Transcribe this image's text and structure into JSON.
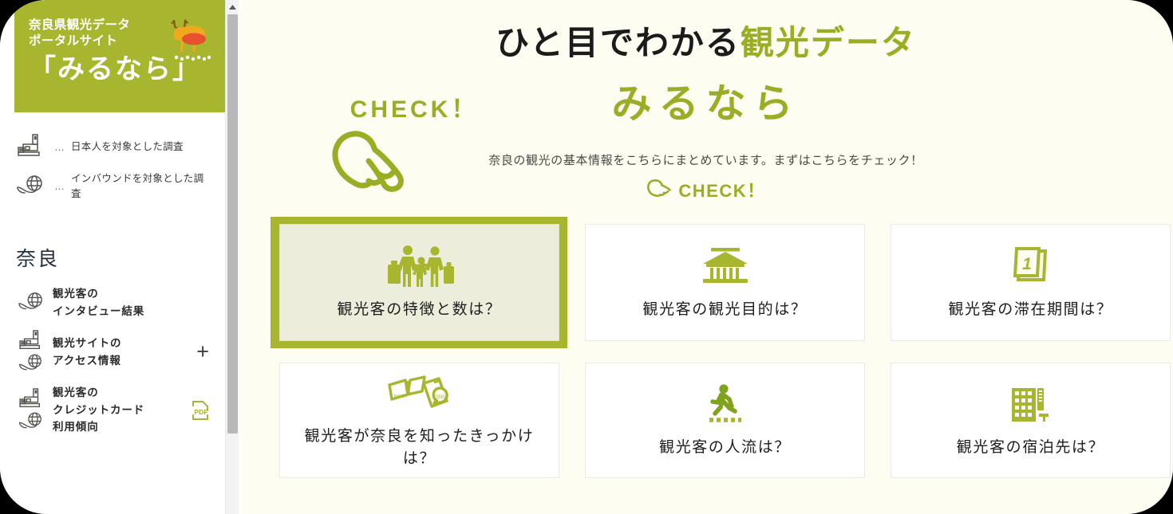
{
  "colors": {
    "brand_green": "#a8b62f",
    "accent_green": "#9aad24",
    "main_bg": "#fdfdf2",
    "card_bg": "#ffffff",
    "selected_card_bg": "#eceedb",
    "text_dark": "#1b1b1b",
    "deer_body": "#e8512f",
    "deer_legs": "#f0a81e"
  },
  "sidebar": {
    "brand": {
      "line1": "奈良県観光データ",
      "line2": "ポータルサイト",
      "main": "「みるなら」",
      "logo_icon": "deer-icon"
    },
    "legend": [
      {
        "icon": "buddha-statue-icon",
        "dots": "…",
        "label": "日本人を対象とした調査"
      },
      {
        "icon": "globe-hand-icon",
        "dots": "…",
        "label": "インバウンドを対象とした調査"
      }
    ],
    "section_title": "奈良",
    "nav_items": [
      {
        "icons": [
          "globe-hand-icon"
        ],
        "label": "観光客の\nインタビュー結果",
        "label_lines": [
          "観光客の",
          "インタビュー結果"
        ],
        "expander": null,
        "badge": null
      },
      {
        "icons": [
          "buddha-statue-icon",
          "globe-hand-icon"
        ],
        "label": "観光サイトの\nアクセス情報",
        "label_lines": [
          "観光サイトの",
          "アクセス情報"
        ],
        "expander": "+",
        "badge": null
      },
      {
        "icons": [
          "buddha-statue-icon",
          "globe-hand-icon"
        ],
        "label": "観光客の\nクレジットカード\n利用傾向",
        "label_lines": [
          "観光客の",
          "クレジットカード",
          "利用傾向"
        ],
        "expander": null,
        "badge": "PDF"
      }
    ]
  },
  "scrollbar": {
    "up_arrow_icon": "chevron-up-icon",
    "thumb_label": "vertical-scroll-thumb"
  },
  "main": {
    "title_dark": "ひと目でわかる",
    "title_green": "観光データ",
    "subtitle": "みるなら",
    "description": "奈良の観光の基本情報をこちらにまとめています。まずはこちらをチェック！",
    "check_label": "CHECK！",
    "check_icon": "pointing-hand-icon",
    "callout": {
      "label": "CHECK！",
      "icon": "pointing-hand-down-icon"
    },
    "cards": [
      {
        "icon": "family-with-luggage-icon",
        "caption": "観光客の特徴と数は？",
        "selected": true
      },
      {
        "icon": "temple-icon",
        "caption": "観光客の観光目的は？",
        "selected": false
      },
      {
        "icon": "calendar-day-1-icon",
        "caption": "観光客の滞在期間は？",
        "selected": false
      },
      {
        "icon": "book-and-smartphone-icon",
        "caption": "観光客が奈良を知ったきっかけは？",
        "selected": false
      },
      {
        "icon": "walking-person-icon",
        "caption": "観光客の人流は？",
        "selected": false
      },
      {
        "icon": "hotel-building-icon",
        "caption": "観光客の宿泊先は？",
        "selected": false
      }
    ]
  }
}
